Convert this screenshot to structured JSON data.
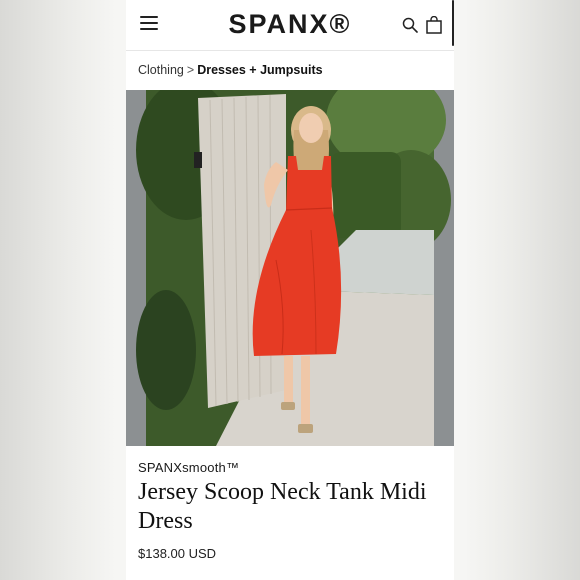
{
  "header": {
    "brand": "SPANX®",
    "menu_icon": "hamburger-icon",
    "search_icon": "search-icon",
    "bag_icon": "shopping-bag-icon"
  },
  "breadcrumb": {
    "parent": "Clothing",
    "separator": ">",
    "current": "Dresses + Jumpsuits"
  },
  "product": {
    "collection": "SPANXsmooth™",
    "title": "Jersey Scoop Neck Tank Midi Dress",
    "price": "$138.00 USD"
  },
  "colors": {
    "dress": "#e63b24",
    "text": "#111111"
  }
}
